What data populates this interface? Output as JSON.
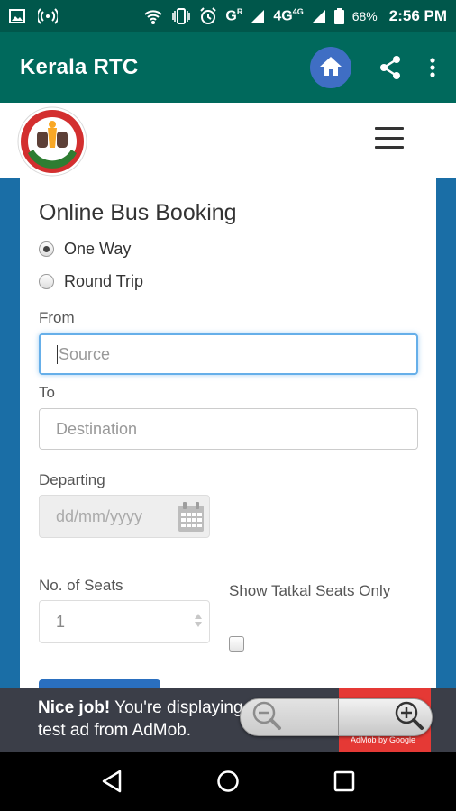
{
  "status_bar": {
    "network_label": "G",
    "network_sup": "R",
    "network2_label": "4G",
    "network2_sup": "4G",
    "battery": "68%",
    "time": "2:56 PM",
    "icons": [
      "image-icon",
      "hotspot-icon",
      "wifi-calling-icon",
      "vibrate-icon",
      "alarm-icon",
      "signal-icon",
      "battery-icon"
    ]
  },
  "app_bar": {
    "title": "Kerala RTC",
    "icons": [
      "home-icon",
      "share-icon",
      "more-vert-icon"
    ],
    "home_color": "#3f6ec4"
  },
  "web_header": {
    "logo": "Kerala State Road Transport Corporation emblem",
    "logo_text": "KERALA STATE",
    "menu_icon": "hamburger-icon"
  },
  "form": {
    "title": "Online Bus Booking",
    "trip_options": [
      {
        "label": "One Way",
        "checked": true
      },
      {
        "label": "Round Trip",
        "checked": false
      }
    ],
    "from_label": "From",
    "from_placeholder": "Source",
    "to_label": "To",
    "to_placeholder": "Destination",
    "departing_label": "Departing",
    "departing_placeholder": "dd/mm/yyyy",
    "seats_label": "No. of Seats",
    "seats_value": "1",
    "tatkal_label": "Show Tatkal Seats Only"
  },
  "ad": {
    "headline": "Nice job!",
    "text": " You're displaying a test ad from AdMob.",
    "badge": "AdMob by Google"
  },
  "nav_bar": {
    "icons": [
      "back-icon",
      "home-circle-icon",
      "recents-icon"
    ]
  },
  "colors": {
    "status_bar": "#00574b",
    "app_bar": "#00695c",
    "background": "#1a6ea6",
    "focus": "#66afe9"
  }
}
